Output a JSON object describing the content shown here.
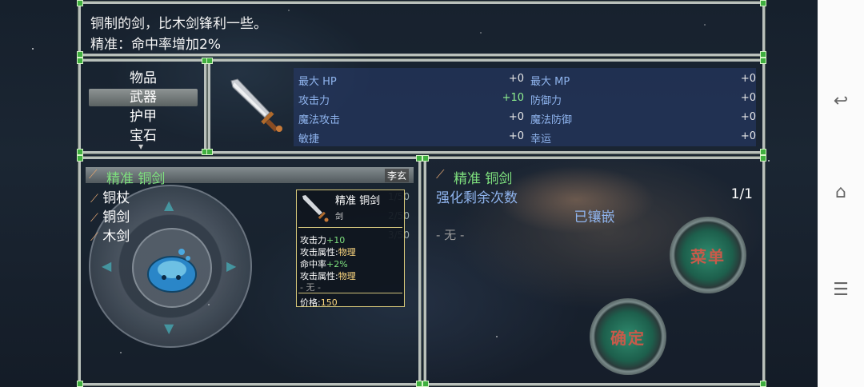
{
  "help": {
    "line1": "铜制的剑，比木剑锋利一些。",
    "line2": "精准：命中率增加2%"
  },
  "categories": [
    {
      "label": "物品",
      "selected": false
    },
    {
      "label": "武器",
      "selected": true
    },
    {
      "label": "护甲",
      "selected": false
    },
    {
      "label": "宝石",
      "selected": false
    }
  ],
  "params": {
    "left": [
      {
        "name": "最大 HP",
        "value": "+0"
      },
      {
        "name": "攻击力",
        "value": "+10"
      },
      {
        "name": "魔法攻击",
        "value": "+0"
      },
      {
        "name": "敏捷",
        "value": "+0"
      }
    ],
    "right": [
      {
        "name": "最大 MP",
        "value": "+0"
      },
      {
        "name": "防御力",
        "value": "+0"
      },
      {
        "name": "魔法防御",
        "value": "+0"
      },
      {
        "name": "幸运",
        "value": "+0"
      }
    ]
  },
  "items": {
    "selected": {
      "name": "精准 铜剑",
      "owner": "李玄"
    },
    "list": [
      {
        "name": "铜杖",
        "count": "1/50"
      },
      {
        "name": "铜剑",
        "count": "2/50"
      },
      {
        "name": "木剑",
        "count": "3/50"
      }
    ]
  },
  "tooltip": {
    "title": "精准 铜剑",
    "type": "剑",
    "lines": [
      {
        "label": "攻击力",
        "value": "+10"
      },
      {
        "label": "攻击属性:",
        "value": "物理"
      },
      {
        "label": "命中率",
        "value": "+2%"
      },
      {
        "label": "攻击属性:",
        "value": "物理"
      }
    ],
    "none": "- 无 -",
    "price_label": "价格:",
    "price": "150"
  },
  "detail": {
    "title": "精准 铜剑",
    "enhance_label": "强化剩余次数",
    "enhance_value": "1/1",
    "inlaid_label": "已镶嵌",
    "none": "- 无 -"
  },
  "buttons": {
    "menu": "菜单",
    "confirm": "确定"
  },
  "colors": {
    "accent_green": "#7ee07e",
    "param_label": "#8fb4ee",
    "frame": "#b9c0bb"
  }
}
